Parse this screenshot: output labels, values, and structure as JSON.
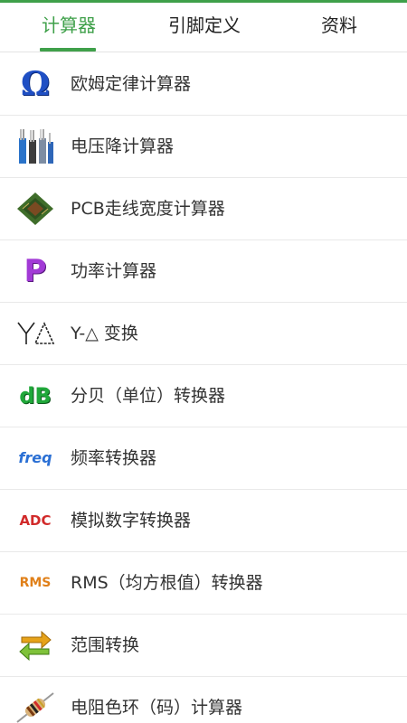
{
  "tabs": [
    {
      "label": "计算器",
      "active": true
    },
    {
      "label": "引脚定义",
      "active": false
    },
    {
      "label": "资料",
      "active": false
    }
  ],
  "items": [
    {
      "label": "欧姆定律计算器",
      "icon": "omega-icon",
      "icon_text": "Ω"
    },
    {
      "label": "电压降计算器",
      "icon": "wire-cable-icon"
    },
    {
      "label": "PCB走线宽度计算器",
      "icon": "pcb-chip-icon"
    },
    {
      "label": "功率计算器",
      "icon": "p-power-icon",
      "icon_text": "P"
    },
    {
      "label": "Y-△ 变换",
      "icon": "y-delta-icon"
    },
    {
      "label": "分贝（单位）转换器",
      "icon": "db-icon",
      "icon_text": "dB"
    },
    {
      "label": "频率转换器",
      "icon": "freq-icon",
      "icon_text": "freq"
    },
    {
      "label": "模拟数字转换器",
      "icon": "adc-icon",
      "icon_text": "ADC"
    },
    {
      "label": "RMS（均方根值）转换器",
      "icon": "rms-icon",
      "icon_text": "RMS"
    },
    {
      "label": "范围转换",
      "icon": "range-arrows-icon"
    },
    {
      "label": "电阻色环（码）计算器",
      "icon": "resistor-icon"
    }
  ],
  "colors": {
    "accent": "#3fa04a",
    "text": "#333333",
    "divider": "#e9e9e9"
  }
}
